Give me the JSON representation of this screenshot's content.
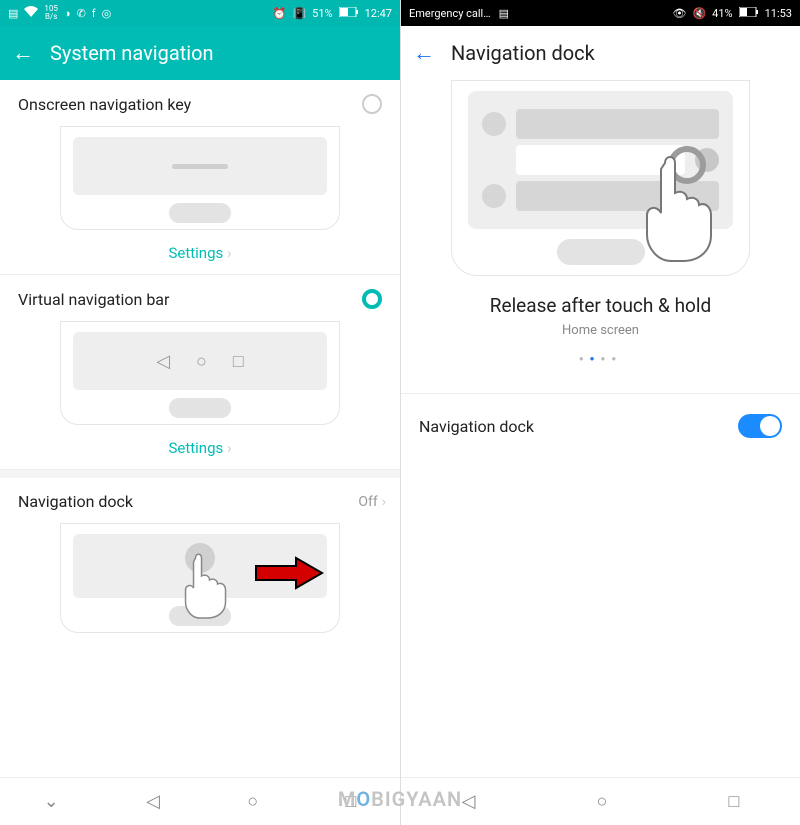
{
  "left": {
    "status": {
      "kbps_num": "105",
      "kbps_unit": "B/s",
      "battery": "51%",
      "time": "12:47"
    },
    "header": {
      "title": "System navigation"
    },
    "opt1": {
      "label": "Onscreen navigation key",
      "settings": "Settings"
    },
    "opt2": {
      "label": "Virtual navigation bar",
      "settings": "Settings"
    },
    "opt3": {
      "label": "Navigation dock",
      "value": "Off"
    }
  },
  "right": {
    "status": {
      "emergency": "Emergency call…",
      "battery": "41%",
      "time": "11:53"
    },
    "header": {
      "title": "Navigation dock"
    },
    "tutorial": {
      "title": "Release after touch & hold",
      "subtitle": "Home screen"
    },
    "toggle": {
      "label": "Navigation dock"
    }
  },
  "watermark": {
    "a": "M",
    "b": "O",
    "c": "BIGYAAN"
  }
}
